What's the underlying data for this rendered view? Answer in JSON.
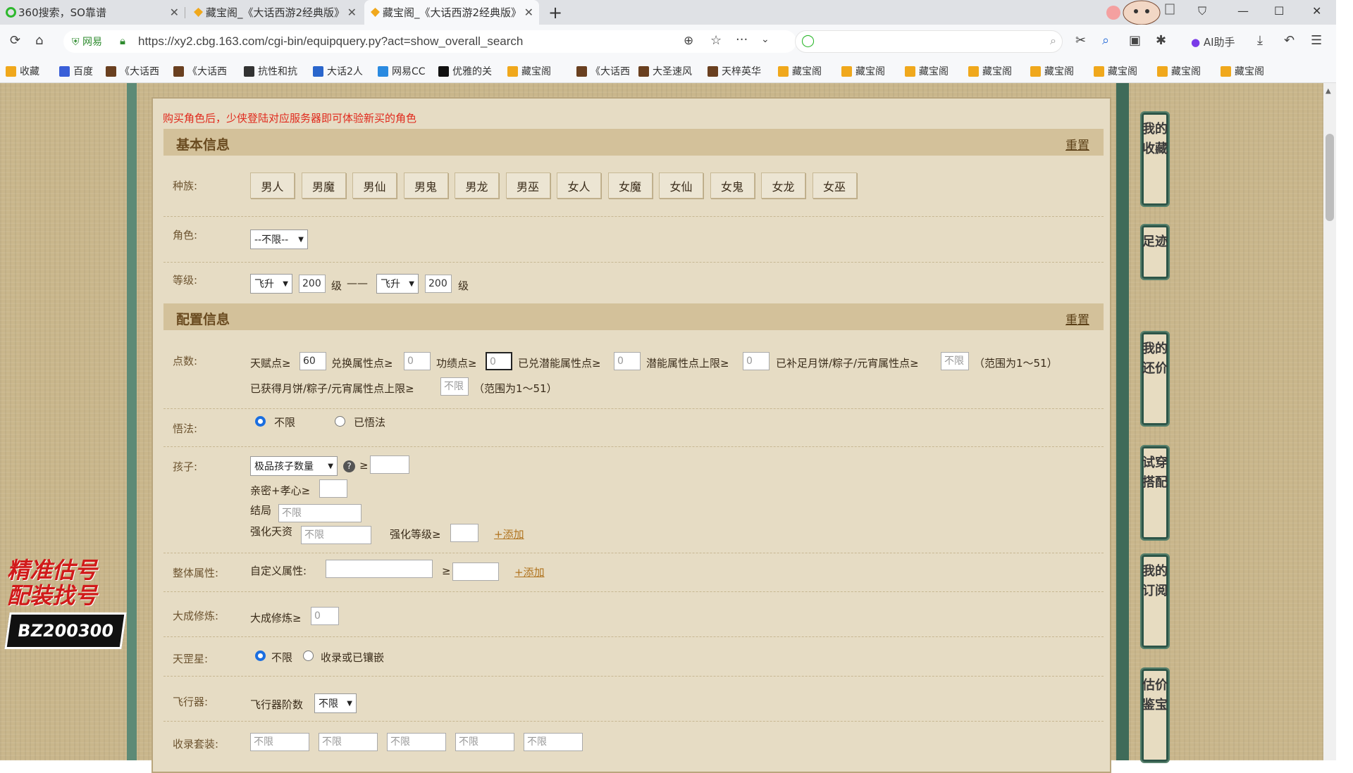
{
  "browser": {
    "tabs": [
      {
        "label": "360搜索，SO靠谱",
        "active": false
      },
      {
        "label": "藏宝阁_《大话西游2经典版》",
        "active": false
      },
      {
        "label": "藏宝阁_《大话西游2经典版》",
        "active": true
      }
    ],
    "new_tab": "+",
    "url": "https://xy2.cbg.163.com/cgi-bin/equipquery.py?act=show_overall_search",
    "site_badge": "网易",
    "ai_label": "AI助手",
    "bookmarks": [
      "收藏",
      "百度",
      "《大话西",
      "《大话西",
      "抗性和抗",
      "大话2人",
      "网易CC",
      "优雅的关",
      "藏宝阁",
      "《大话西",
      "大圣速风",
      "天梓英华",
      "藏宝阁",
      "藏宝阁",
      "藏宝阁",
      "藏宝阁",
      "藏宝阁",
      "藏宝阁",
      "藏宝阁",
      "藏宝阁"
    ]
  },
  "page": {
    "notice": "购买角色后，少侠登陆对应服务器即可体验新买的角色",
    "basic": {
      "title": "基本信息",
      "reset": "重置",
      "race_label": "种族:",
      "races": [
        "男人",
        "男魔",
        "男仙",
        "男鬼",
        "男龙",
        "男巫",
        "女人",
        "女魔",
        "女仙",
        "女鬼",
        "女龙",
        "女巫"
      ],
      "role_label": "角色:",
      "role_value": "--不限--",
      "level_label": "等级:",
      "level_from_select": "飞升",
      "level_from": "200",
      "level_unit": "级",
      "dash": "——",
      "level_to_select": "飞升",
      "level_to": "200"
    },
    "config": {
      "title": "配置信息",
      "reset": "重置",
      "points_label": "点数:",
      "talent_label": "天赋点≥",
      "talent_value": "60",
      "exchange_label": "兑换属性点≥",
      "exchange_value": "0",
      "merit_label": "功绩点≥",
      "merit_value": "0",
      "potential_label": "已兑潜能属性点≥",
      "potential_value": "0",
      "potential_max_label": "潜能属性点上限≥",
      "potential_max_value": "0",
      "mooncake_label": "已补足月饼/粽子/元宵属性点≥",
      "mooncake_value": "不限",
      "range1": "（范围为1～51）",
      "mooncake_max_label": "已获得月饼/粽子/元宵属性点上限≥",
      "mooncake_max_value": "不限",
      "range2": "（范围为1～51）",
      "wufa_label": "悟法:",
      "wufa_opt1": "不限",
      "wufa_opt2": "已悟法",
      "child_label": "孩子:",
      "child_select": "极品孩子数量",
      "ge": "≥",
      "intimacy_label": "亲密+孝心≥",
      "ending_label": "结局",
      "ending_placeholder": "不限",
      "enhance_label": "强化天资",
      "enhance_placeholder": "不限",
      "enhance_level_label": "强化等级≥",
      "add": "+添加",
      "overall_label": "整体属性:",
      "custom_label": "自定义属性:",
      "add2": "+添加",
      "dacheng_label": "大成修炼:",
      "dacheng_inner": "大成修炼≥",
      "dacheng_value": "0",
      "tiangang_label": "天罡星:",
      "tiangang_opt1": "不限",
      "tiangang_opt2": "收录或已镶嵌",
      "aircraft_label": "飞行器:",
      "aircraft_inner": "飞行器阶数",
      "aircraft_value": "不限",
      "suit_label": "收录套装:",
      "suit_values": [
        "不限",
        "不限",
        "不限",
        "不限",
        "不限"
      ]
    }
  },
  "sidebar": [
    "我的收藏",
    "足迹",
    "我的还价",
    "试穿搭配",
    "我的订阅",
    "估价鉴宝"
  ],
  "promo": {
    "line1": "精准估号",
    "line2": "配装找号",
    "code": "BZ200300"
  }
}
